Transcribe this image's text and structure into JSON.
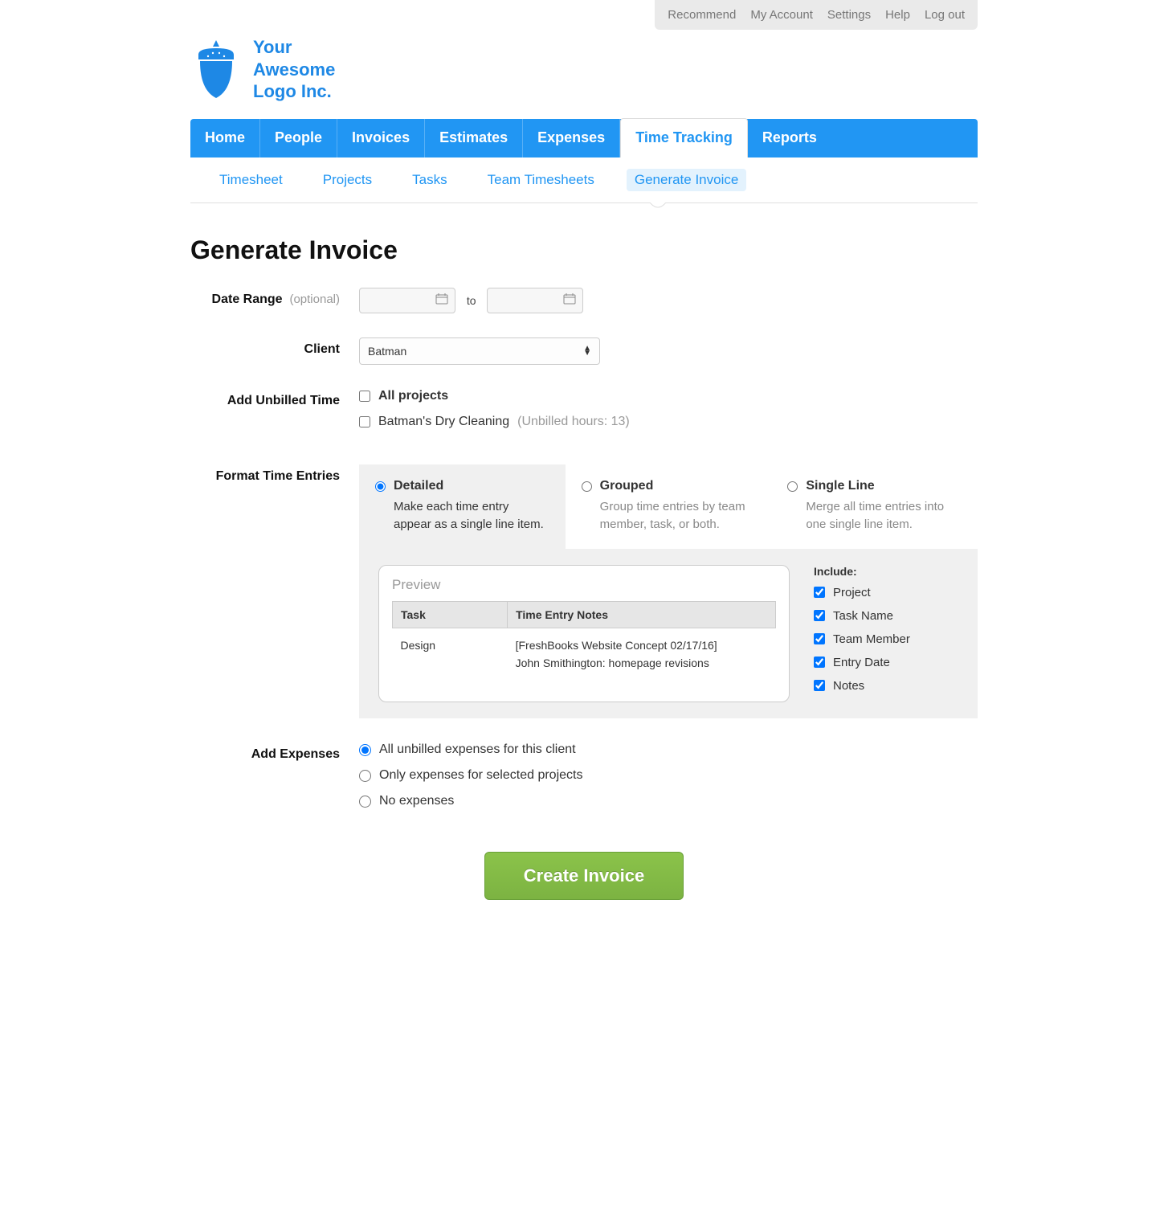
{
  "utility_nav": [
    "Recommend",
    "My Account",
    "Settings",
    "Help",
    "Log out"
  ],
  "logo": {
    "line1": "Your",
    "line2": "Awesome",
    "line3": "Logo Inc."
  },
  "main_tabs": [
    "Home",
    "People",
    "Invoices",
    "Estimates",
    "Expenses",
    "Time Tracking",
    "Reports"
  ],
  "main_tab_active": 5,
  "sub_tabs": [
    "Timesheet",
    "Projects",
    "Tasks",
    "Team Timesheets",
    "Generate Invoice"
  ],
  "sub_tab_active": 4,
  "page_title": "Generate Invoice",
  "labels": {
    "date_range": "Date Range",
    "optional": "(optional)",
    "to": "to",
    "client": "Client",
    "add_unbilled": "Add Unbilled Time",
    "format_entries": "Format Time Entries",
    "add_expenses": "Add Expenses",
    "include": "Include:",
    "preview": "Preview"
  },
  "client_value": "Batman",
  "unbilled": {
    "all_label": "All projects",
    "project_name": "Batman's Dry Cleaning",
    "project_hours": "(Unbilled hours: 13)"
  },
  "formats": [
    {
      "title": "Detailed",
      "desc": "Make each time entry appear as a single line item."
    },
    {
      "title": "Grouped",
      "desc": "Group time entries by team member, task, or both."
    },
    {
      "title": "Single Line",
      "desc": "Merge all time entries into one single line item."
    }
  ],
  "format_selected": 0,
  "preview_table": {
    "headers": [
      "Task",
      "Time Entry Notes"
    ],
    "task": "Design",
    "notes_line1": "[FreshBooks Website Concept 02/17/16]",
    "notes_line2": "John Smithington: homepage revisions"
  },
  "include_opts": [
    "Project",
    "Task Name",
    "Team Member",
    "Entry Date",
    "Notes"
  ],
  "expenses": [
    "All unbilled expenses for this client",
    "Only expenses for selected projects",
    "No expenses"
  ],
  "expense_selected": 0,
  "create_btn": "Create Invoice"
}
